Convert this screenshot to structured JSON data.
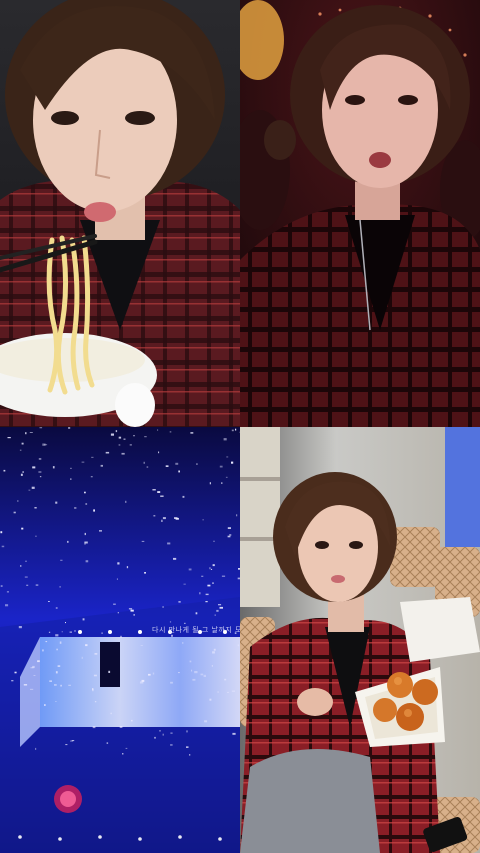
{
  "collage": {
    "tiles": [
      {
        "scene": "selfie eating noodles with chopsticks",
        "tone": "warm indoor"
      },
      {
        "scene": "selfie in concert crowd",
        "tone": "dark red stage lights"
      },
      {
        "scene": "concert stage with falling confetti and large LED screen",
        "tone": "blue and purple"
      },
      {
        "scene": "person holding open takeout box of fried snacks",
        "tone": "stadium seating"
      }
    ],
    "stage_caption": "다시 만나게 될 그 날까지 모두 행복하길"
  },
  "colors": {
    "sweater_red": "#7a1c24",
    "stage_blue": "#1a2ad8",
    "confetti": "#e8e8ff",
    "skin": "#e9c9b8",
    "hair": "#3a2418"
  }
}
